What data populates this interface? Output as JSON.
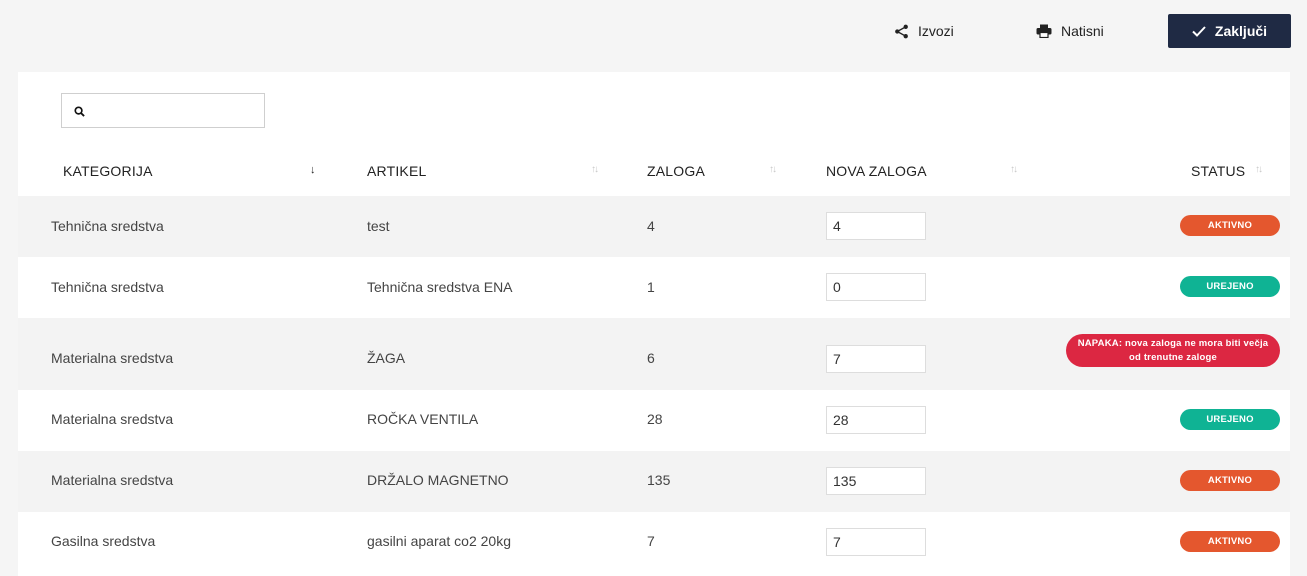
{
  "toolbar": {
    "export_label": "Izvozi",
    "print_label": "Natisni",
    "close_label": "Zaključi"
  },
  "search": {
    "placeholder": "",
    "value": ""
  },
  "table": {
    "columns": [
      "KATEGORIJA",
      "ARTIKEL",
      "ZALOGA",
      "NOVA ZALOGA",
      "STATUS"
    ],
    "rows": [
      {
        "kategorija": "Tehnična sredstva",
        "artikel": "test",
        "zaloga": "4",
        "nova_zaloga": "4",
        "status": "AKTIVNO"
      },
      {
        "kategorija": "Tehnična sredstva",
        "artikel": "Tehnična sredstva ENA",
        "zaloga": "1",
        "nova_zaloga": "0",
        "status": "UREJENO"
      },
      {
        "kategorija": "Materialna sredstva",
        "artikel": "ŽAGA",
        "zaloga": "6",
        "nova_zaloga": "7",
        "status": "NAPAKA: nova zaloga ne mora biti večja od trenutne zaloge"
      },
      {
        "kategorija": "Materialna sredstva",
        "artikel": "ROČKA VENTILA",
        "zaloga": "28",
        "nova_zaloga": "28",
        "status": "UREJENO"
      },
      {
        "kategorija": "Materialna sredstva",
        "artikel": "DRŽALO MAGNETNO",
        "zaloga": "135",
        "nova_zaloga": "135",
        "status": "AKTIVNO"
      },
      {
        "kategorija": "Gasilna sredstva",
        "artikel": "gasilni aparat co2 20kg",
        "zaloga": "7",
        "nova_zaloga": "7",
        "status": "AKTIVNO"
      }
    ]
  },
  "colors": {
    "aktivno": "#e4572e",
    "urejeno": "#0fb394",
    "napaka": "#dc2742",
    "primary_button": "#1f2a44"
  }
}
